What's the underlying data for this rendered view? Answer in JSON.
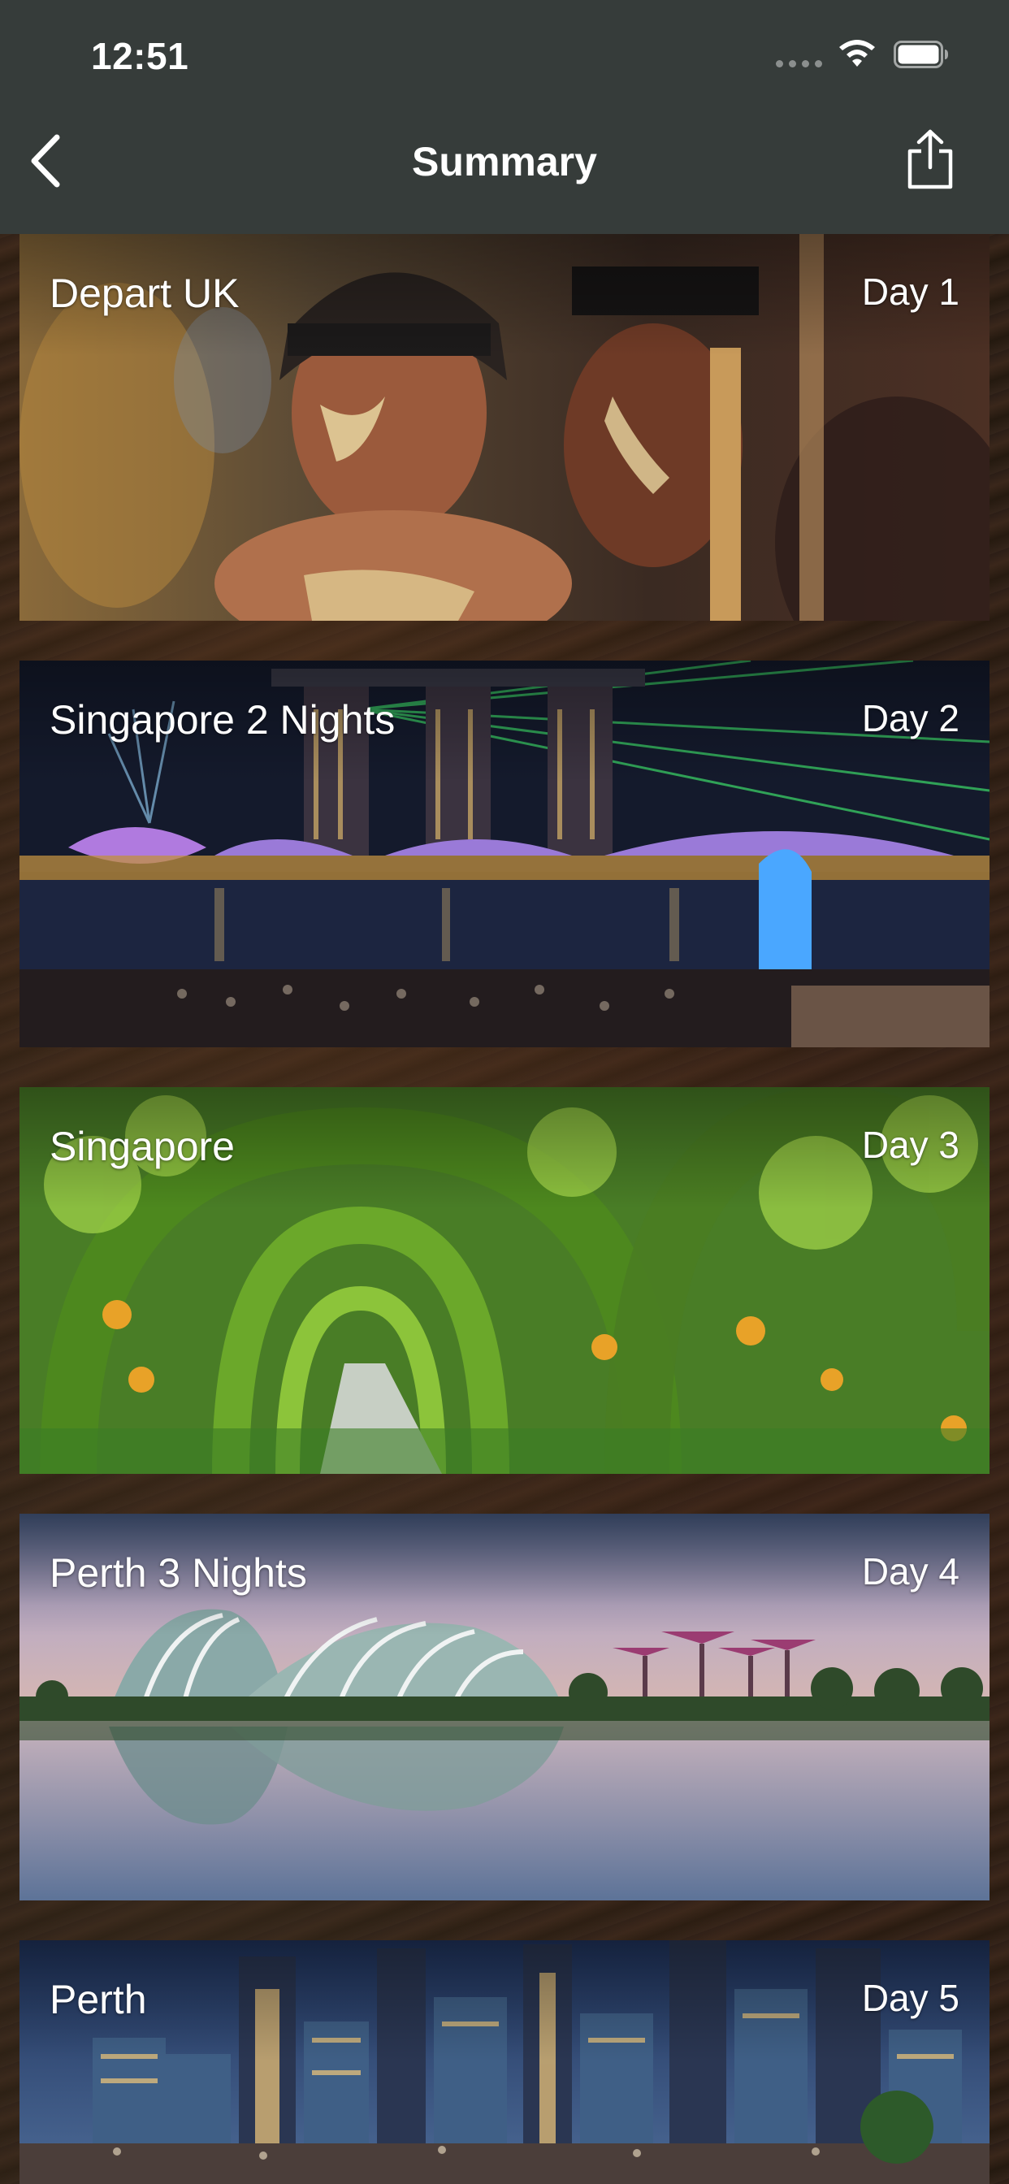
{
  "status_bar": {
    "time": "12:51"
  },
  "nav": {
    "title": "Summary",
    "back_icon": "chevron-left-icon",
    "share_icon": "share-icon"
  },
  "itinerary": [
    {
      "name": "Depart UK",
      "day": "Day 1"
    },
    {
      "name": "Singapore 2 Nights",
      "day": "Day 2"
    },
    {
      "name": "Singapore",
      "day": "Day 3"
    },
    {
      "name": "Perth 3 Nights",
      "day": "Day 4"
    },
    {
      "name": "Perth",
      "day": "Day 5"
    }
  ],
  "colors": {
    "nav_background": "#363c3a",
    "text": "#ffffff"
  }
}
